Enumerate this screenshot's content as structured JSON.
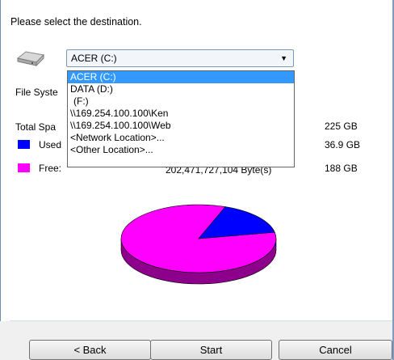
{
  "prompt": "Please select the destination.",
  "destination": {
    "selected": "ACER (C:)",
    "options": [
      "ACER (C:)",
      "DATA (D:)",
      "(F:)",
      "\\\\169.254.100.100\\Ken",
      "\\\\169.254.100.100\\Web",
      "<Network Location>...",
      "<Other Location>..."
    ]
  },
  "info": {
    "file_system_label": "File Syste",
    "total_label": "Total Spa",
    "total_value": "225  GB",
    "used_label": "Used",
    "used_value": "36.9  GB",
    "free_label": "Free:",
    "free_bytes": "202,471,727,104  Byte(s)",
    "free_value": "188  GB"
  },
  "colors": {
    "used": "#0000ff",
    "free": "#ff00ff",
    "selection": "#3399ff"
  },
  "pie_usage": {
    "used_gb": 36.9,
    "free_gb": 188
  },
  "buttons": {
    "back": "< Back",
    "start": "Start",
    "cancel": "Cancel"
  },
  "icons": {
    "drive": "drive-icon",
    "dropdown_arrow": "chevron-down-icon"
  }
}
